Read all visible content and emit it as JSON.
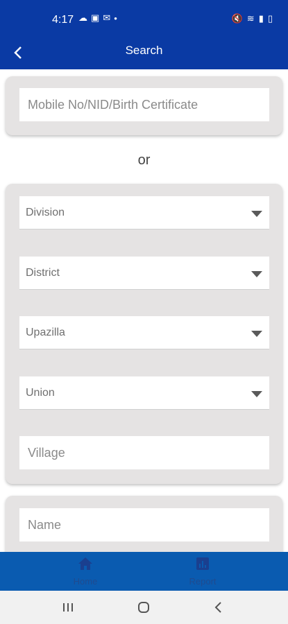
{
  "status_bar": {
    "time": "4:17"
  },
  "header": {
    "title": "Search"
  },
  "search": {
    "placeholder": "Mobile No/NID/Birth Certificate"
  },
  "separator": "or",
  "filters": {
    "division": "Division",
    "district": "District",
    "upazilla": "Upazilla",
    "union": "Union",
    "village_placeholder": "Village"
  },
  "name": {
    "placeholder": "Name"
  },
  "bottom_nav": {
    "items": [
      {
        "label": "Home",
        "icon": "home-icon"
      },
      {
        "label": "Report",
        "icon": "report-icon"
      }
    ]
  },
  "colors": {
    "primary": "#0a3aa4",
    "nav": "#0a5bb0",
    "card": "#e5e3e3"
  }
}
